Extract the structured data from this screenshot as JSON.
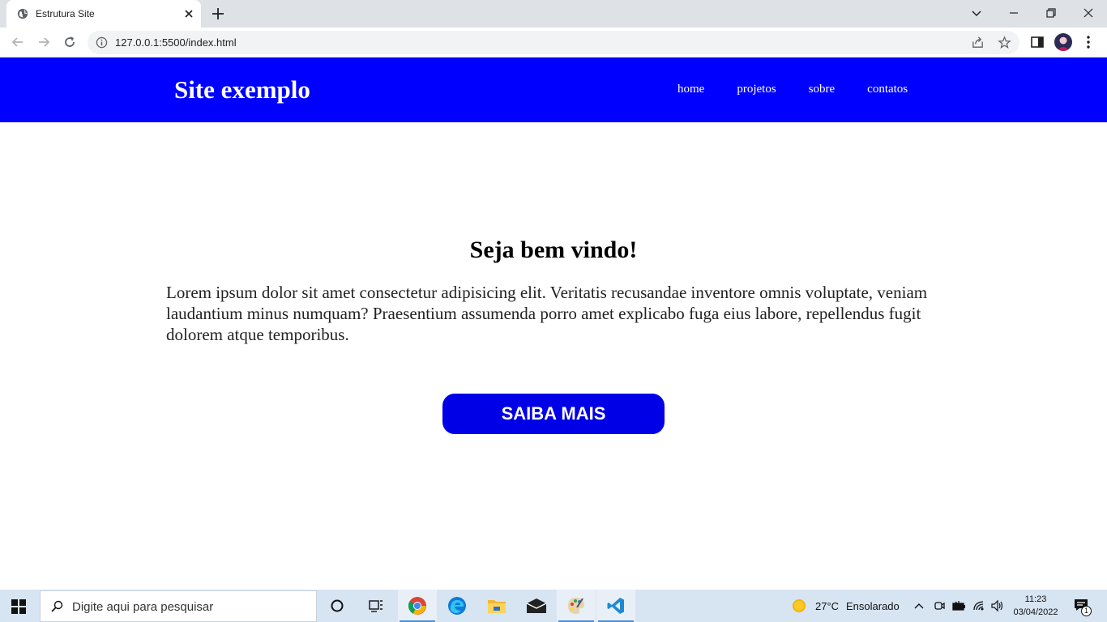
{
  "browser": {
    "tab_title": "Estrutura Site",
    "url": "127.0.0.1:5500/index.html"
  },
  "site": {
    "logo": "Site exemplo",
    "nav": [
      "home",
      "projetos",
      "sobre",
      "contatos"
    ],
    "heading": "Seja bem vindo!",
    "paragraph": "Lorem ipsum dolor sit amet consectetur adipisicing elit. Veritatis recusandae inventore omnis voluptate, veniam laudantium minus numquam? Praesentium assumenda porro amet explicabo fuga eius labore, repellendus fugit dolorem atque temporibus.",
    "cta_label": "SAIBA MAIS"
  },
  "taskbar": {
    "search_placeholder": "Digite aqui para pesquisar",
    "weather_temp": "27°C",
    "weather_desc": "Ensolarado",
    "time": "11:23",
    "date": "03/04/2022",
    "notification_count": "1"
  },
  "colors": {
    "header_bg": "#0000ff",
    "cta_bg": "#0000e6"
  }
}
